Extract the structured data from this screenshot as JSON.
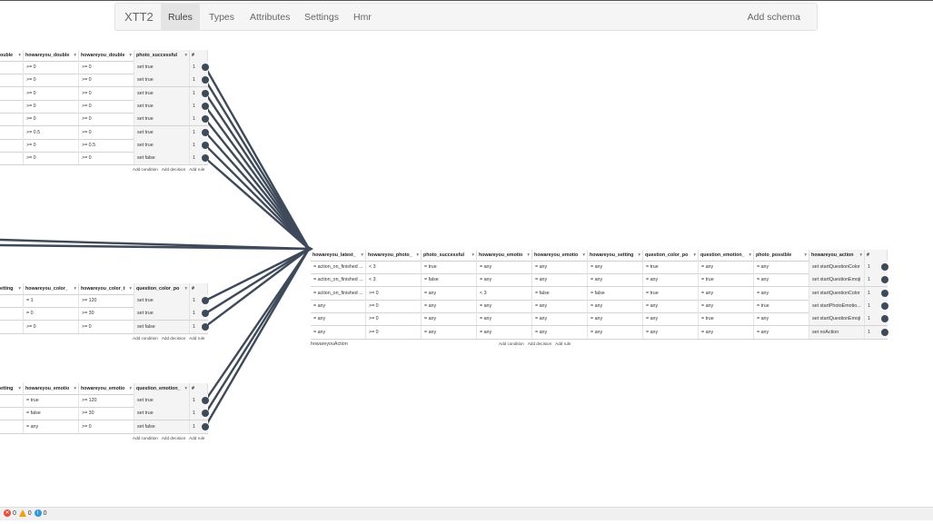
{
  "navbar": {
    "brand": "XTT2",
    "items": [
      {
        "label": "Rules",
        "active": true
      },
      {
        "label": "Types",
        "active": false
      },
      {
        "label": "Attributes",
        "active": false
      },
      {
        "label": "Settings",
        "active": false
      },
      {
        "label": "Hmr",
        "active": false
      }
    ],
    "add_schema": "Add schema"
  },
  "colors": {
    "edge": "#3e4a5a",
    "handle": "#3e4a5a",
    "accent_error": "#e74c3c",
    "accent_warning": "#f39c12",
    "accent_info": "#3498db"
  },
  "tables": [
    {
      "id": "photo",
      "headers": [
        "ouble",
        "howareyou_double",
        "howareyou_double",
        "photo_successful",
        "#"
      ],
      "rows": [
        [
          ">= 0",
          ">= 0",
          "set true",
          "1"
        ],
        [
          ">= 0",
          ">= 0",
          "set true",
          "1"
        ],
        [
          ">= 0",
          ">= 0",
          "set true",
          "1"
        ],
        [
          ">= 0",
          ">= 0",
          "set true",
          "1"
        ],
        [
          ">= 0",
          ">= 0",
          "set true",
          "1"
        ],
        [
          ">= 0.5",
          ">= 0",
          "set true",
          "1"
        ],
        [
          ">= 0",
          ">= 0.5",
          "set true",
          "1"
        ],
        [
          ">= 0",
          ">= 0",
          "set false",
          "1"
        ]
      ],
      "actions": [
        "Add condition",
        "Add decision",
        "Add rule"
      ]
    },
    {
      "id": "color",
      "headers": [
        "etting",
        "howareyou_color_",
        "howareyou_color_t",
        "question_color_po",
        "#"
      ],
      "rows": [
        [
          "= 1",
          ">= 120",
          "set true",
          "1"
        ],
        [
          "= 0",
          ">= 30",
          "set true",
          "1"
        ],
        [
          ">= 0",
          ">= 0",
          "set false",
          "1"
        ]
      ],
      "actions": [
        "Add condition",
        "Add decision",
        "Add rule"
      ]
    },
    {
      "id": "emotion",
      "headers": [
        "etting",
        "howareyou_emotio",
        "howareyou_emotio",
        "question_emotion_",
        "#"
      ],
      "rows": [
        [
          "= true",
          ">= 120",
          "set true",
          "1"
        ],
        [
          "= false",
          ">= 30",
          "set true",
          "1"
        ],
        [
          "= any",
          ">= 0",
          "set false",
          "1"
        ]
      ],
      "actions": [
        "Add condition",
        "Add decision",
        "Add rule"
      ]
    },
    {
      "id": "action",
      "name": "howareyouAction",
      "headers": [
        "howareyou_latest_",
        "howareyou_photo_",
        "photo_successful",
        "howareyou_emotio",
        "howareyou_emotio",
        "howareyou_setting",
        "question_color_po",
        "question_emotion_",
        "photo_possible",
        "howareyou_action",
        "#"
      ],
      "rows": [
        [
          "= action_on_finished ...",
          "< 3",
          "= true",
          "= any",
          "= any",
          "= any",
          "= true",
          "= any",
          "= any",
          "set startQuestionColor",
          "1"
        ],
        [
          "= action_on_finished ...",
          "< 3",
          "= false",
          "= any",
          "= any",
          "= any",
          "= any",
          "= true",
          "= any",
          "set startQuestionEmoji",
          "1"
        ],
        [
          "= action_on_finished ...",
          ">= 0",
          "= any",
          "< 3",
          "= false",
          "= false",
          "= true",
          "= any",
          "= any",
          "set startQuestionColor",
          "1"
        ],
        [
          "= any",
          ">= 0",
          "= any",
          "= any",
          "= any",
          "= any",
          "= any",
          "= any",
          "= true",
          "set startPhotoEmotio...",
          "1"
        ],
        [
          "= any",
          ">= 0",
          "= any",
          "= any",
          "= any",
          "= any",
          "= any",
          "= true",
          "= any",
          "set startQuestionEmoji",
          "1"
        ],
        [
          "= any",
          ">= 0",
          "= any",
          "= any",
          "= any",
          "= any",
          "= any",
          "= any",
          "= any",
          "set noAction",
          "1"
        ]
      ],
      "actions": [
        "Add condition",
        "Add decision",
        "Add rule"
      ]
    }
  ],
  "status_bar": {
    "errors": "0",
    "warnings": "0",
    "infos": "0"
  }
}
